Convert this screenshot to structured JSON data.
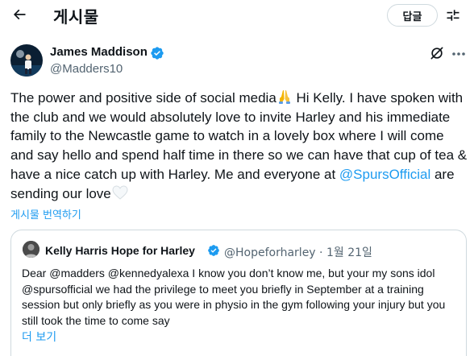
{
  "header": {
    "title": "게시물",
    "reply_label": "답글"
  },
  "tweet": {
    "author": {
      "name": "James Maddison",
      "handle": "@Madders10"
    },
    "text_part1": "The power and positive side of social media",
    "text_part2": " Hi Kelly. I have spoken with the club and we would absolutely love to invite Harley and his immediate family to the Newcastle game to watch in a lovely box where I will come and say hello and spend half time in there so we can have that cup of tea & have a nice catch up with Harley. Me and everyone at ",
    "mention": "@SpursOfficial",
    "text_part3": " are sending our love",
    "emojis": [
      "folded-hands",
      "white-heart"
    ],
    "translate_label": "게시물 번역하기"
  },
  "quote": {
    "author": {
      "name": "Kelly Harris Hope for Harley",
      "handle": "@Hopeforharley",
      "separator": "·",
      "date": "1월 21일"
    },
    "text": "Dear @madders @kennedyalexa I know you don’t know me,  but your my sons idol @spursofficial we had the privilege to meet you briefly in September at a training session but only briefly as you were in physio in the gym following your injury but you still took the time to come say",
    "show_more": "더 보기"
  },
  "colors": {
    "text": "#0f1419",
    "secondary": "#536471",
    "link": "#1d9bf0",
    "border": "#cfd9de",
    "verified": "#1d9bf0"
  }
}
